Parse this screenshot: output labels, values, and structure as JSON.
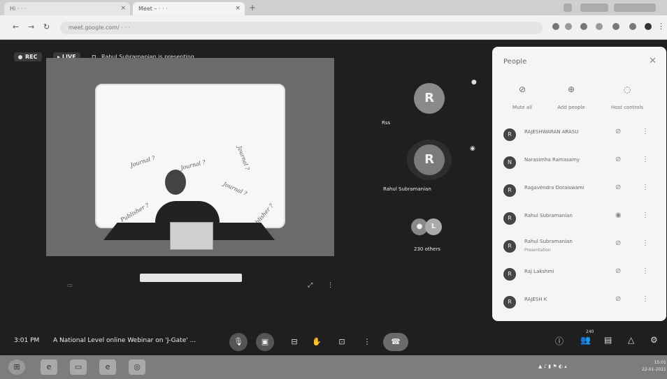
{
  "browser": {
    "tabs": [
      {
        "title": "Hi  ·  ·  ·"
      },
      {
        "title": "Meet – ·  ·  ·"
      }
    ],
    "new_tab_glyph": "+",
    "url": "meet.google.com/  ·  ·  ·"
  },
  "meet": {
    "rec_label": "REC",
    "live_label": "LIVE",
    "presenting_text": "Rahul Subramanian is presenting",
    "slide_words": [
      "Journal ?",
      "Journal ?",
      "Publisher ?",
      "Journal ?",
      "Publisher ?",
      "Journal ?"
    ],
    "participants": [
      {
        "name": "Rss",
        "initial": "R"
      },
      {
        "name": "Rahul Subramanian",
        "initial": "R"
      }
    ],
    "others": {
      "label": "230 others",
      "initial": "L"
    }
  },
  "people_panel": {
    "title": "People",
    "actions": [
      {
        "label": "Mute all",
        "icon": "mic-off-icon"
      },
      {
        "label": "Add people",
        "icon": "add-person-icon"
      },
      {
        "label": "Host controls",
        "icon": "shield-icon"
      }
    ],
    "people": [
      {
        "name": "RAJESHWARAN ARASU",
        "sub": "",
        "initial": "R"
      },
      {
        "name": "Narasimha Ramasamy",
        "sub": "",
        "initial": "N"
      },
      {
        "name": "Ragavendra Doraiswami",
        "sub": "",
        "initial": "R"
      },
      {
        "name": "Rahul Subramanian",
        "sub": "",
        "initial": "R"
      },
      {
        "name": "Rahul Subramanian",
        "sub": "Presentation",
        "initial": "R"
      },
      {
        "name": "Raj Lakshmi",
        "sub": "",
        "initial": "R"
      },
      {
        "name": "RAJESH K",
        "sub": "",
        "initial": "R"
      }
    ]
  },
  "bottombar": {
    "clock": "3:01 PM",
    "meeting_name": "A National Level online Webinar on 'J-Gate' ...",
    "participant_count": "240"
  },
  "taskbar": {
    "time": "15:01",
    "date": "22-01-2021"
  }
}
